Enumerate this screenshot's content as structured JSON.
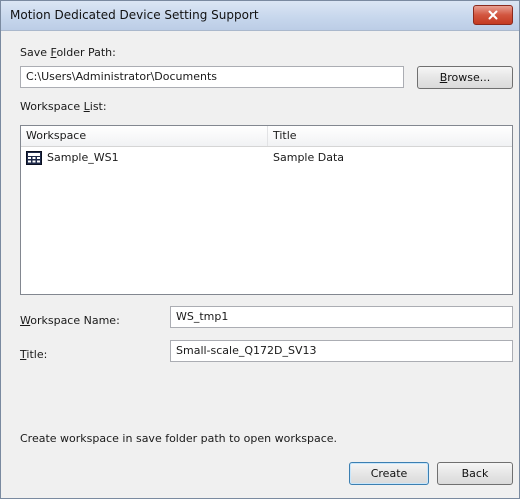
{
  "window": {
    "title": "Motion Dedicated Device Setting Support",
    "close_icon": "close-icon"
  },
  "save_folder": {
    "label_before": "Save ",
    "label_accel": "F",
    "label_after": "older Path:",
    "value": "C:\\Users\\Administrator\\Documents",
    "browse_accel": "B",
    "browse_after": "rowse..."
  },
  "workspace_list": {
    "label_before": "Workspace ",
    "label_accel": "L",
    "label_after": "ist:",
    "columns": [
      "Workspace",
      "Title"
    ],
    "rows": [
      {
        "workspace": "Sample_WS1",
        "title": "Sample Data",
        "icon": "workspace-icon"
      }
    ]
  },
  "workspace_name": {
    "label_accel": "W",
    "label_after": "orkspace Name:",
    "value": "WS_tmp1"
  },
  "title_field": {
    "label_accel": "T",
    "label_after": "itle:",
    "value": "Small-scale_Q172D_SV13"
  },
  "info_message": "Create workspace in save folder path to open workspace.",
  "buttons": {
    "create": "Create",
    "back": "Back"
  }
}
